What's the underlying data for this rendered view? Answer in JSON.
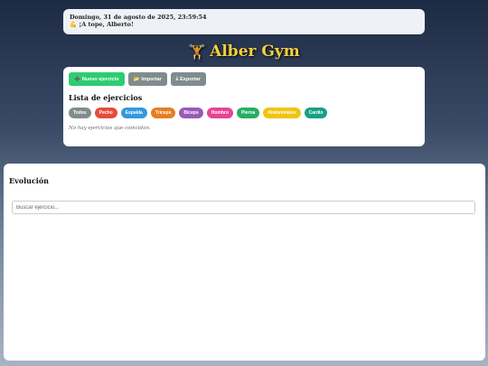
{
  "greeting": {
    "date": "Domingo, 31 de agosto de 2025, 23:59:54",
    "icon": "flexed-bicep",
    "message": "¡A tope, Alberto!"
  },
  "header": {
    "icon": "weightlifter",
    "title": "Alber Gym"
  },
  "toolbar": {
    "new_label": "Nuevo ejercicio",
    "import_label": "Importar",
    "export_label": "Exportar"
  },
  "list": {
    "title": "Lista de ejercicios",
    "filters": [
      {
        "label": "Todos",
        "color": "#7f8c8d"
      },
      {
        "label": "Pecho",
        "color": "#e74c3c"
      },
      {
        "label": "Espalda",
        "color": "#3498db"
      },
      {
        "label": "Tríceps",
        "color": "#e67e22"
      },
      {
        "label": "Bíceps",
        "color": "#9b59b6"
      },
      {
        "label": "Hombro",
        "color": "#e84393"
      },
      {
        "label": "Pierna",
        "color": "#27ae60"
      },
      {
        "label": "Abdominales",
        "color": "#f1c40f"
      },
      {
        "label": "Cardio",
        "color": "#16a085"
      }
    ],
    "empty_message": "No hay ejercicios que coincidan."
  },
  "evolution": {
    "title": "Evolución",
    "search_placeholder": "Buscar ejercicio..."
  }
}
